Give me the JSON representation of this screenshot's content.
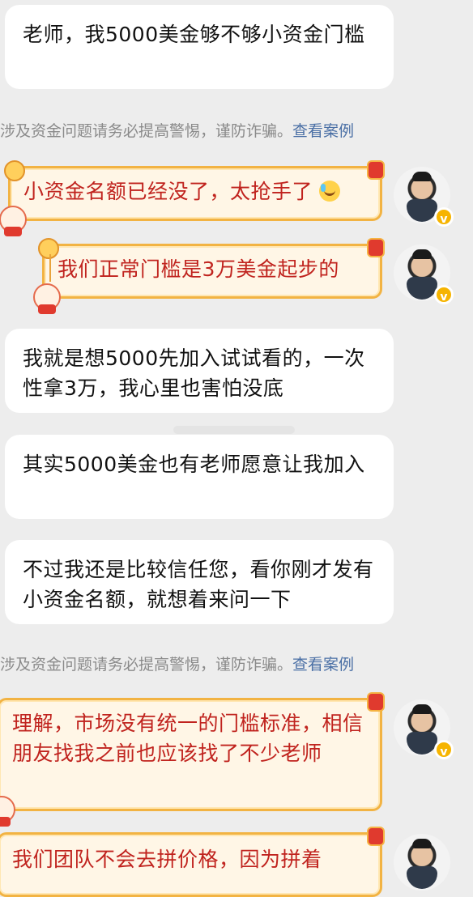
{
  "messages": [
    {
      "id": "m1",
      "side": "left",
      "text": "老师，我5000美金够不够小资金门槛"
    },
    {
      "id": "sys1",
      "side": "system",
      "text": "涉及资金问题请务必提高警惕，谨防诈骗。",
      "link": "查看案例"
    },
    {
      "id": "m2",
      "side": "right",
      "text": "小资金名额已经没了，太抢手了",
      "emoji": "laugh-cry-emoji"
    },
    {
      "id": "m3",
      "side": "right",
      "text": "我们正常门槛是3万美金起步的"
    },
    {
      "id": "m4",
      "side": "left",
      "text": "我就是想5000先加入试试看的，一次性拿3万，我心里也害怕没底"
    },
    {
      "id": "m5",
      "side": "left",
      "text": "其实5000美金也有老师愿意让我加入"
    },
    {
      "id": "m6",
      "side": "left",
      "text": "不过我还是比较信任您，看你刚才发有小资金名额，就想着来问一下"
    },
    {
      "id": "sys2",
      "side": "system",
      "text": "涉及资金问题请务必提高警惕，谨防诈骗。",
      "link": "查看案例"
    },
    {
      "id": "m7",
      "side": "right",
      "text": "理解，市场没有统一的门槛标准，相信朋友找我之前也应该找了不少老师"
    },
    {
      "id": "m8",
      "side": "right",
      "text": "我们团队不会去拼价格，因为拼着"
    }
  ],
  "avatar": {
    "badge": "v",
    "icon": "verified-badge-icon"
  },
  "colors": {
    "background": "#ededed",
    "left_bubble": "#ffffff",
    "right_bubble_text": "#c0231e",
    "right_bubble_border": "#f2b343",
    "system_text": "#8a8a8a",
    "link": "#4a6fa5"
  }
}
